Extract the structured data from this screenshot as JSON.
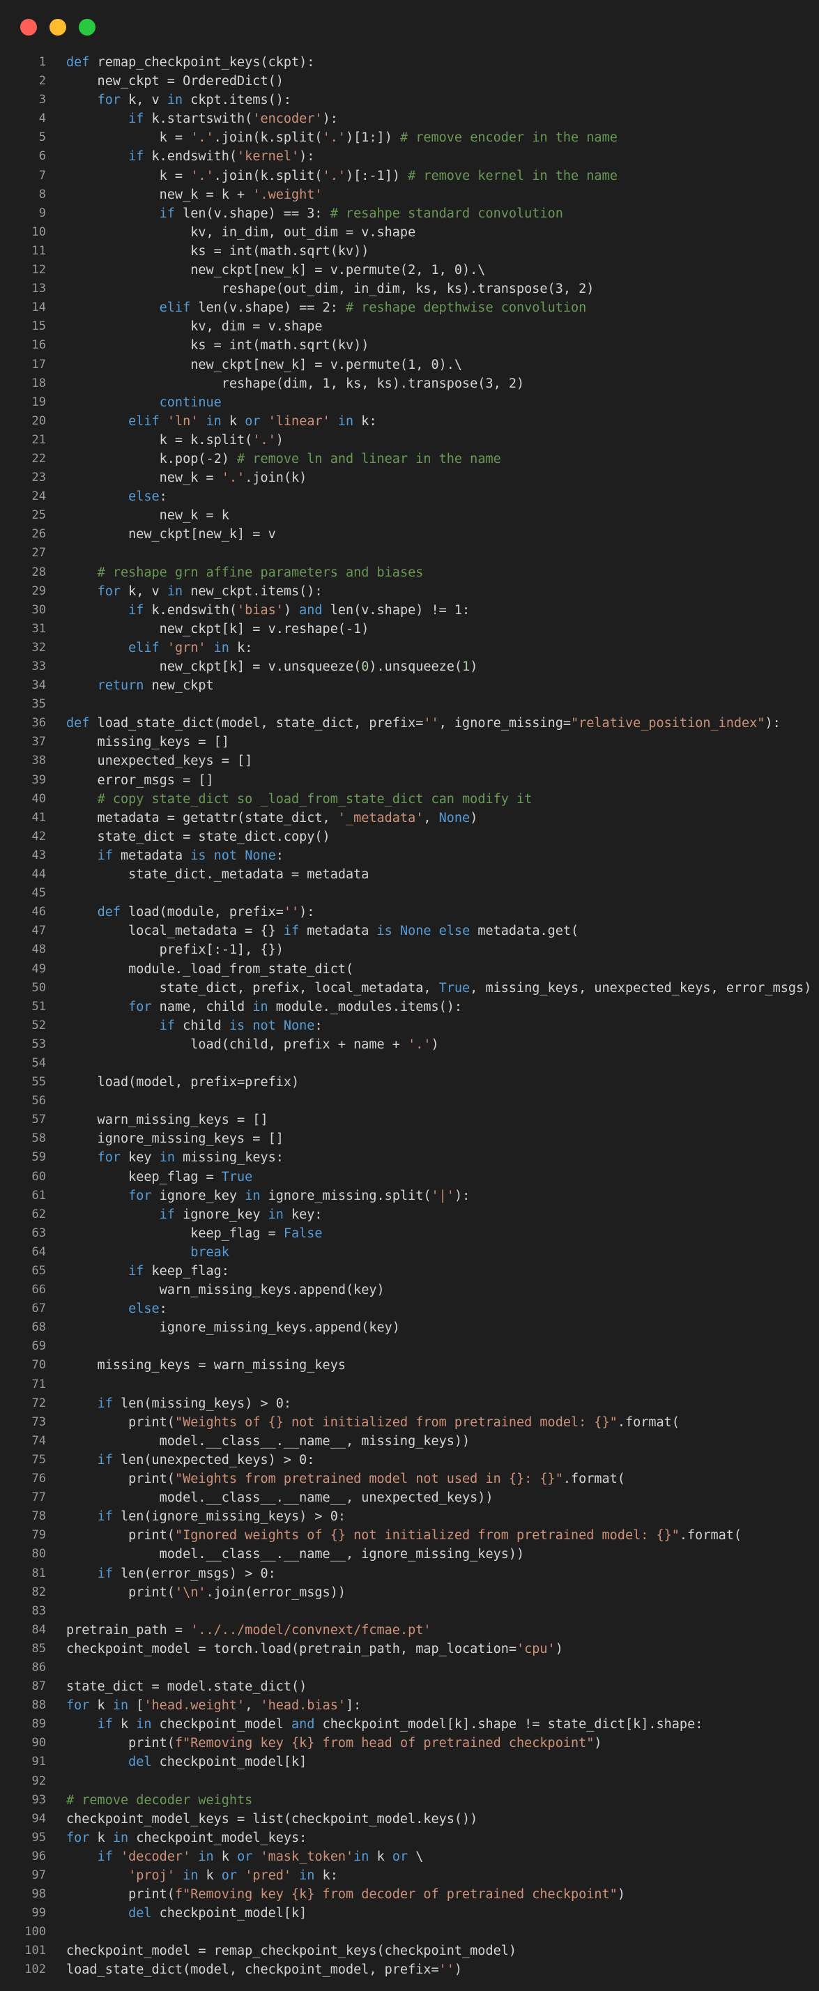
{
  "window": {
    "controls": {
      "close_color": "#ff5f57",
      "minimize_color": "#febc2e",
      "maximize_color": "#28c840"
    }
  },
  "theme": {
    "background": "#1e1e1e",
    "text": "#d4d4d4",
    "keyword": "#569cd6",
    "string": "#ce9178",
    "comment": "#6a9955",
    "number": "#b5cea8",
    "line_number": "#9a9a9a"
  },
  "code_lines": [
    [
      [
        "kw",
        "def"
      ],
      [
        "p",
        " remap_checkpoint_keys(ckpt):"
      ]
    ],
    [
      [
        "p",
        "    new_ckpt = OrderedDict()"
      ]
    ],
    [
      [
        "p",
        "    "
      ],
      [
        "kw",
        "for"
      ],
      [
        "p",
        " k, v "
      ],
      [
        "kw",
        "in"
      ],
      [
        "p",
        " ckpt.items():"
      ]
    ],
    [
      [
        "p",
        "        "
      ],
      [
        "kw",
        "if"
      ],
      [
        "p",
        " k.startswith("
      ],
      [
        "str",
        "'encoder'"
      ],
      [
        "p",
        "):"
      ]
    ],
    [
      [
        "p",
        "            k = "
      ],
      [
        "str",
        "'.'"
      ],
      [
        "p",
        ".join(k.split("
      ],
      [
        "str",
        "'.'"
      ],
      [
        "p",
        ")[1:]) "
      ],
      [
        "com",
        "# remove encoder in the name"
      ]
    ],
    [
      [
        "p",
        "        "
      ],
      [
        "kw",
        "if"
      ],
      [
        "p",
        " k.endswith("
      ],
      [
        "str",
        "'kernel'"
      ],
      [
        "p",
        "):"
      ]
    ],
    [
      [
        "p",
        "            k = "
      ],
      [
        "str",
        "'.'"
      ],
      [
        "p",
        ".join(k.split("
      ],
      [
        "str",
        "'.'"
      ],
      [
        "p",
        ")[:-1]) "
      ],
      [
        "com",
        "# remove kernel in the name"
      ]
    ],
    [
      [
        "p",
        "            new_k = k + "
      ],
      [
        "str",
        "'.weight'"
      ]
    ],
    [
      [
        "p",
        "            "
      ],
      [
        "kw",
        "if"
      ],
      [
        "p",
        " len(v.shape) == 3: "
      ],
      [
        "com",
        "# resahpe standard convolution"
      ]
    ],
    [
      [
        "p",
        "                kv, in_dim, out_dim = v.shape"
      ]
    ],
    [
      [
        "p",
        "                ks = int(math.sqrt(kv))"
      ]
    ],
    [
      [
        "p",
        "                new_ckpt[new_k] = v.permute(2, 1, 0).\\"
      ]
    ],
    [
      [
        "p",
        "                    reshape(out_dim, in_dim, ks, ks).transpose(3, 2)"
      ]
    ],
    [
      [
        "p",
        "            "
      ],
      [
        "kw",
        "elif"
      ],
      [
        "p",
        " len(v.shape) == 2: "
      ],
      [
        "com",
        "# reshape depthwise convolution"
      ]
    ],
    [
      [
        "p",
        "                kv, dim = v.shape"
      ]
    ],
    [
      [
        "p",
        "                ks = int(math.sqrt(kv))"
      ]
    ],
    [
      [
        "p",
        "                new_ckpt[new_k] = v.permute(1, 0).\\"
      ]
    ],
    [
      [
        "p",
        "                    reshape(dim, 1, ks, ks).transpose(3, 2)"
      ]
    ],
    [
      [
        "p",
        "            "
      ],
      [
        "kw",
        "continue"
      ]
    ],
    [
      [
        "p",
        "        "
      ],
      [
        "kw",
        "elif"
      ],
      [
        "p",
        " "
      ],
      [
        "str",
        "'ln'"
      ],
      [
        "p",
        " "
      ],
      [
        "kw",
        "in"
      ],
      [
        "p",
        " k "
      ],
      [
        "kw",
        "or"
      ],
      [
        "p",
        " "
      ],
      [
        "str",
        "'linear'"
      ],
      [
        "p",
        " "
      ],
      [
        "kw",
        "in"
      ],
      [
        "p",
        " k:"
      ]
    ],
    [
      [
        "p",
        "            k = k.split("
      ],
      [
        "str",
        "'.'"
      ],
      [
        "p",
        ")"
      ]
    ],
    [
      [
        "p",
        "            k.pop(-2) "
      ],
      [
        "com",
        "# remove ln and linear in the name"
      ]
    ],
    [
      [
        "p",
        "            new_k = "
      ],
      [
        "str",
        "'.'"
      ],
      [
        "p",
        ".join(k)"
      ]
    ],
    [
      [
        "p",
        "        "
      ],
      [
        "kw",
        "else"
      ],
      [
        "p",
        ":"
      ]
    ],
    [
      [
        "p",
        "            new_k = k"
      ]
    ],
    [
      [
        "p",
        "        new_ckpt[new_k] = v"
      ]
    ],
    [],
    [
      [
        "p",
        "    "
      ],
      [
        "com",
        "# reshape grn affine parameters and biases"
      ]
    ],
    [
      [
        "p",
        "    "
      ],
      [
        "kw",
        "for"
      ],
      [
        "p",
        " k, v "
      ],
      [
        "kw",
        "in"
      ],
      [
        "p",
        " new_ckpt.items():"
      ]
    ],
    [
      [
        "p",
        "        "
      ],
      [
        "kw",
        "if"
      ],
      [
        "p",
        " k.endswith("
      ],
      [
        "str",
        "'bias'"
      ],
      [
        "p",
        ") "
      ],
      [
        "kw",
        "and"
      ],
      [
        "p",
        " len(v.shape) != 1:"
      ]
    ],
    [
      [
        "p",
        "            new_ckpt[k] = v.reshape(-1)"
      ]
    ],
    [
      [
        "p",
        "        "
      ],
      [
        "kw",
        "elif"
      ],
      [
        "p",
        " "
      ],
      [
        "str",
        "'grn'"
      ],
      [
        "p",
        " "
      ],
      [
        "kw",
        "in"
      ],
      [
        "p",
        " k:"
      ]
    ],
    [
      [
        "p",
        "            new_ckpt[k] = v.unsqueeze("
      ],
      [
        "num",
        "0"
      ],
      [
        "p",
        ").unsqueeze("
      ],
      [
        "num",
        "1"
      ],
      [
        "p",
        ")"
      ]
    ],
    [
      [
        "p",
        "    "
      ],
      [
        "kw",
        "return"
      ],
      [
        "p",
        " new_ckpt"
      ]
    ],
    [],
    [
      [
        "kw",
        "def"
      ],
      [
        "p",
        " load_state_dict(model, state_dict, prefix="
      ],
      [
        "str",
        "''"
      ],
      [
        "p",
        ", ignore_missing="
      ],
      [
        "str",
        "\"relative_position_index\""
      ],
      [
        "p",
        "):"
      ]
    ],
    [
      [
        "p",
        "    missing_keys = []"
      ]
    ],
    [
      [
        "p",
        "    unexpected_keys = []"
      ]
    ],
    [
      [
        "p",
        "    error_msgs = []"
      ]
    ],
    [
      [
        "p",
        "    "
      ],
      [
        "com",
        "# copy state_dict so _load_from_state_dict can modify it"
      ]
    ],
    [
      [
        "p",
        "    metadata = getattr(state_dict, "
      ],
      [
        "str",
        "'_metadata'"
      ],
      [
        "p",
        ", "
      ],
      [
        "kw",
        "None"
      ],
      [
        "p",
        ")"
      ]
    ],
    [
      [
        "p",
        "    state_dict = state_dict.copy()"
      ]
    ],
    [
      [
        "p",
        "    "
      ],
      [
        "kw",
        "if"
      ],
      [
        "p",
        " metadata "
      ],
      [
        "kw",
        "is not None"
      ],
      [
        "p",
        ":"
      ]
    ],
    [
      [
        "p",
        "        state_dict._metadata = metadata"
      ]
    ],
    [],
    [
      [
        "p",
        "    "
      ],
      [
        "kw",
        "def"
      ],
      [
        "p",
        " load(module, prefix="
      ],
      [
        "str",
        "''"
      ],
      [
        "p",
        "):"
      ]
    ],
    [
      [
        "p",
        "        local_metadata = {} "
      ],
      [
        "kw",
        "if"
      ],
      [
        "p",
        " metadata "
      ],
      [
        "kw",
        "is None"
      ],
      [
        "p",
        " "
      ],
      [
        "kw",
        "else"
      ],
      [
        "p",
        " metadata.get("
      ]
    ],
    [
      [
        "p",
        "            prefix[:-1], {})"
      ]
    ],
    [
      [
        "p",
        "        module._load_from_state_dict("
      ]
    ],
    [
      [
        "p",
        "            state_dict, prefix, local_metadata, "
      ],
      [
        "kw",
        "True"
      ],
      [
        "p",
        ", missing_keys, unexpected_keys, error_msgs)"
      ]
    ],
    [
      [
        "p",
        "        "
      ],
      [
        "kw",
        "for"
      ],
      [
        "p",
        " name, child "
      ],
      [
        "kw",
        "in"
      ],
      [
        "p",
        " module._modules.items():"
      ]
    ],
    [
      [
        "p",
        "            "
      ],
      [
        "kw",
        "if"
      ],
      [
        "p",
        " child "
      ],
      [
        "kw",
        "is not None"
      ],
      [
        "p",
        ":"
      ]
    ],
    [
      [
        "p",
        "                load(child, prefix + name + "
      ],
      [
        "str",
        "'.'"
      ],
      [
        "p",
        ")"
      ]
    ],
    [],
    [
      [
        "p",
        "    load(model, prefix=prefix)"
      ]
    ],
    [],
    [
      [
        "p",
        "    warn_missing_keys = []"
      ]
    ],
    [
      [
        "p",
        "    ignore_missing_keys = []"
      ]
    ],
    [
      [
        "p",
        "    "
      ],
      [
        "kw",
        "for"
      ],
      [
        "p",
        " key "
      ],
      [
        "kw",
        "in"
      ],
      [
        "p",
        " missing_keys:"
      ]
    ],
    [
      [
        "p",
        "        keep_flag = "
      ],
      [
        "kw",
        "True"
      ]
    ],
    [
      [
        "p",
        "        "
      ],
      [
        "kw",
        "for"
      ],
      [
        "p",
        " ignore_key "
      ],
      [
        "kw",
        "in"
      ],
      [
        "p",
        " ignore_missing.split("
      ],
      [
        "str",
        "'|'"
      ],
      [
        "p",
        "):"
      ]
    ],
    [
      [
        "p",
        "            "
      ],
      [
        "kw",
        "if"
      ],
      [
        "p",
        " ignore_key "
      ],
      [
        "kw",
        "in"
      ],
      [
        "p",
        " key:"
      ]
    ],
    [
      [
        "p",
        "                keep_flag = "
      ],
      [
        "kw",
        "False"
      ]
    ],
    [
      [
        "p",
        "                "
      ],
      [
        "kw",
        "break"
      ]
    ],
    [
      [
        "p",
        "        "
      ],
      [
        "kw",
        "if"
      ],
      [
        "p",
        " keep_flag:"
      ]
    ],
    [
      [
        "p",
        "            warn_missing_keys.append(key)"
      ]
    ],
    [
      [
        "p",
        "        "
      ],
      [
        "kw",
        "else"
      ],
      [
        "p",
        ":"
      ]
    ],
    [
      [
        "p",
        "            ignore_missing_keys.append(key)"
      ]
    ],
    [],
    [
      [
        "p",
        "    missing_keys = warn_missing_keys"
      ]
    ],
    [],
    [
      [
        "p",
        "    "
      ],
      [
        "kw",
        "if"
      ],
      [
        "p",
        " len(missing_keys) > 0:"
      ]
    ],
    [
      [
        "p",
        "        print("
      ],
      [
        "str",
        "\"Weights of {} not initialized from pretrained model: {}\""
      ],
      [
        "p",
        ".format("
      ]
    ],
    [
      [
        "p",
        "            model.__class__.__name__, missing_keys))"
      ]
    ],
    [
      [
        "p",
        "    "
      ],
      [
        "kw",
        "if"
      ],
      [
        "p",
        " len(unexpected_keys) > 0:"
      ]
    ],
    [
      [
        "p",
        "        print("
      ],
      [
        "str",
        "\"Weights from pretrained model not used in {}: {}\""
      ],
      [
        "p",
        ".format("
      ]
    ],
    [
      [
        "p",
        "            model.__class__.__name__, unexpected_keys))"
      ]
    ],
    [
      [
        "p",
        "    "
      ],
      [
        "kw",
        "if"
      ],
      [
        "p",
        " len(ignore_missing_keys) > 0:"
      ]
    ],
    [
      [
        "p",
        "        print("
      ],
      [
        "str",
        "\"Ignored weights of {} not initialized from pretrained model: {}\""
      ],
      [
        "p",
        ".format("
      ]
    ],
    [
      [
        "p",
        "            model.__class__.__name__, ignore_missing_keys))"
      ]
    ],
    [
      [
        "p",
        "    "
      ],
      [
        "kw",
        "if"
      ],
      [
        "p",
        " len(error_msgs) > 0:"
      ]
    ],
    [
      [
        "p",
        "        print("
      ],
      [
        "str",
        "'\\n'"
      ],
      [
        "p",
        ".join(error_msgs))"
      ]
    ],
    [],
    [
      [
        "p",
        "pretrain_path = "
      ],
      [
        "str",
        "'../../model/convnext/fcmae.pt'"
      ]
    ],
    [
      [
        "p",
        "checkpoint_model = torch.load(pretrain_path, map_location="
      ],
      [
        "str",
        "'cpu'"
      ],
      [
        "p",
        ")"
      ]
    ],
    [],
    [
      [
        "p",
        "state_dict = model.state_dict()"
      ]
    ],
    [
      [
        "kw",
        "for"
      ],
      [
        "p",
        " k "
      ],
      [
        "kw",
        "in"
      ],
      [
        "p",
        " ["
      ],
      [
        "str",
        "'head.weight'"
      ],
      [
        "p",
        ", "
      ],
      [
        "str",
        "'head.bias'"
      ],
      [
        "p",
        "]:"
      ]
    ],
    [
      [
        "p",
        "    "
      ],
      [
        "kw",
        "if"
      ],
      [
        "p",
        " k "
      ],
      [
        "kw",
        "in"
      ],
      [
        "p",
        " checkpoint_model "
      ],
      [
        "kw",
        "and"
      ],
      [
        "p",
        " checkpoint_model[k].shape != state_dict[k].shape:"
      ]
    ],
    [
      [
        "p",
        "        print("
      ],
      [
        "str",
        "f\"Removing key {k} from head of pretrained checkpoint\""
      ],
      [
        "p",
        ")"
      ]
    ],
    [
      [
        "p",
        "        "
      ],
      [
        "kw",
        "del"
      ],
      [
        "p",
        " checkpoint_model[k]"
      ]
    ],
    [],
    [
      [
        "com",
        "# remove decoder weights"
      ]
    ],
    [
      [
        "p",
        "checkpoint_model_keys = list(checkpoint_model.keys())"
      ]
    ],
    [
      [
        "kw",
        "for"
      ],
      [
        "p",
        " k "
      ],
      [
        "kw",
        "in"
      ],
      [
        "p",
        " checkpoint_model_keys:"
      ]
    ],
    [
      [
        "p",
        "    "
      ],
      [
        "kw",
        "if"
      ],
      [
        "p",
        " "
      ],
      [
        "str",
        "'decoder'"
      ],
      [
        "p",
        " "
      ],
      [
        "kw",
        "in"
      ],
      [
        "p",
        " k "
      ],
      [
        "kw",
        "or"
      ],
      [
        "p",
        " "
      ],
      [
        "str",
        "'mask_token'"
      ],
      [
        "kw",
        "in"
      ],
      [
        "p",
        " k "
      ],
      [
        "kw",
        "or"
      ],
      [
        "p",
        " \\"
      ]
    ],
    [
      [
        "p",
        "        "
      ],
      [
        "str",
        "'proj'"
      ],
      [
        "p",
        " "
      ],
      [
        "kw",
        "in"
      ],
      [
        "p",
        " k "
      ],
      [
        "kw",
        "or"
      ],
      [
        "p",
        " "
      ],
      [
        "str",
        "'pred'"
      ],
      [
        "p",
        " "
      ],
      [
        "kw",
        "in"
      ],
      [
        "p",
        " k:"
      ]
    ],
    [
      [
        "p",
        "        print("
      ],
      [
        "str",
        "f\"Removing key {k} from decoder of pretrained checkpoint\""
      ],
      [
        "p",
        ")"
      ]
    ],
    [
      [
        "p",
        "        "
      ],
      [
        "kw",
        "del"
      ],
      [
        "p",
        " checkpoint_model[k]"
      ]
    ],
    [],
    [
      [
        "p",
        "checkpoint_model = remap_checkpoint_keys(checkpoint_model)"
      ]
    ],
    [
      [
        "p",
        "load_state_dict(model, checkpoint_model, prefix="
      ],
      [
        "str",
        "''"
      ],
      [
        "p",
        ")"
      ]
    ]
  ]
}
